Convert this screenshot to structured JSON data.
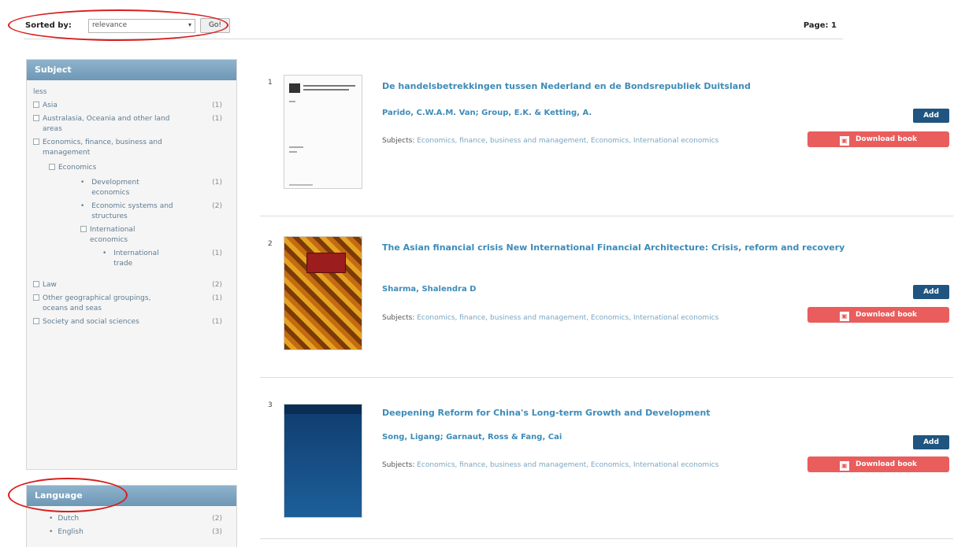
{
  "toolbar": {
    "sorted_by_label": "Sorted by:",
    "sort_value": "relevance",
    "go_label": "Go!",
    "page_label": "Page: 1"
  },
  "subject_facet": {
    "heading": "Subject",
    "less_link": "less",
    "items": [
      {
        "label": "Asia",
        "count": "(1)"
      },
      {
        "label": "Australasia, Oceania and other land areas",
        "count": "(1)"
      },
      {
        "label": "Economics, finance, business and management",
        "count": ""
      },
      {
        "label": "Economics",
        "count": ""
      },
      {
        "label": "Development economics",
        "count": "(1)"
      },
      {
        "label": "Economic systems and structures",
        "count": "(2)"
      },
      {
        "label": "International economics",
        "count": ""
      },
      {
        "label": "International trade",
        "count": "(1)"
      },
      {
        "label": "Law",
        "count": "(2)"
      },
      {
        "label": "Other geographical groupings, oceans and seas",
        "count": "(1)"
      },
      {
        "label": "Society and social sciences",
        "count": "(1)"
      }
    ]
  },
  "language_facet": {
    "heading": "Language",
    "items": [
      {
        "label": "Dutch",
        "count": "(2)"
      },
      {
        "label": "English",
        "count": "(3)"
      }
    ]
  },
  "results": [
    {
      "number": "1",
      "title": "De handelsbetrekkingen tussen Nederland en de Bondsrepubliek Duitsland",
      "authors": "Parido, C.W.A.M. Van; Group, E.K. & Ketting, A.",
      "subjects_label": "Subjects:",
      "subjects": "Economics, finance, business and management, Economics, International economics",
      "add_label": "Add",
      "download_label": "Download book"
    },
    {
      "number": "2",
      "title": "The Asian financial crisis New International Financial Architecture: Crisis, reform and recovery",
      "authors": "Sharma, Shalendra D",
      "subjects_label": "Subjects:",
      "subjects": "Economics, finance, business and management, Economics, International economics",
      "add_label": "Add",
      "download_label": "Download book"
    },
    {
      "number": "3",
      "title": "Deepening Reform for China's Long-term Growth and Development",
      "authors": "Song, Ligang; Garnaut, Ross & Fang, Cai",
      "subjects_label": "Subjects:",
      "subjects": "Economics, finance, business and management, Economics, International economics",
      "add_label": "Add",
      "download_label": "Download book"
    }
  ],
  "colors": {
    "accent": "#3d8bb8",
    "add_button": "#1f5580",
    "download_button": "#e95d5d",
    "annotation_ring": "#d81e1e"
  }
}
